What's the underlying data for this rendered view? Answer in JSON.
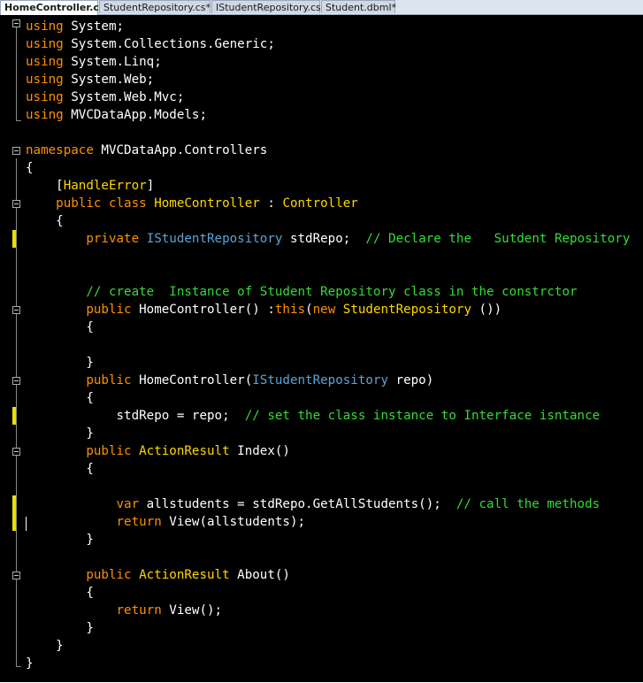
{
  "tabs": [
    {
      "label": "HomeController.cs*",
      "active": true
    },
    {
      "label": "StudentRepository.cs*",
      "active": false
    },
    {
      "label": "IStudentRepository.cs",
      "active": false
    },
    {
      "label": "Student.dbml*",
      "active": false
    }
  ],
  "colors": {
    "background": "#000000",
    "keyword": "#ff9000",
    "type": "#5aa5d6",
    "class": "#ffd700",
    "comment": "#33dd33",
    "plain": "#ffffff"
  },
  "code_lines": [
    [
      {
        "t": "kw",
        "v": "using"
      },
      {
        "t": "pl",
        "v": " System;"
      }
    ],
    [
      {
        "t": "kw",
        "v": "using"
      },
      {
        "t": "pl",
        "v": " System.Collections.Generic;"
      }
    ],
    [
      {
        "t": "kw",
        "v": "using"
      },
      {
        "t": "pl",
        "v": " System.Linq;"
      }
    ],
    [
      {
        "t": "kw",
        "v": "using"
      },
      {
        "t": "pl",
        "v": " System.Web;"
      }
    ],
    [
      {
        "t": "kw",
        "v": "using"
      },
      {
        "t": "pl",
        "v": " System.Web.Mvc;"
      }
    ],
    [
      {
        "t": "kw",
        "v": "using"
      },
      {
        "t": "pl",
        "v": " MVCDataApp.Models;"
      }
    ],
    [],
    [
      {
        "t": "kw",
        "v": "namespace"
      },
      {
        "t": "pl",
        "v": " MVCDataApp.Controllers"
      }
    ],
    [
      {
        "t": "pl",
        "v": "{"
      }
    ],
    [
      {
        "t": "pl",
        "v": "    ["
      },
      {
        "t": "cl",
        "v": "HandleError"
      },
      {
        "t": "pl",
        "v": "]"
      }
    ],
    [
      {
        "t": "pl",
        "v": "    "
      },
      {
        "t": "kw",
        "v": "public class"
      },
      {
        "t": "pl",
        "v": " "
      },
      {
        "t": "cl",
        "v": "HomeController"
      },
      {
        "t": "pl",
        "v": " : "
      },
      {
        "t": "cl",
        "v": "Controller"
      }
    ],
    [
      {
        "t": "pl",
        "v": "    {"
      }
    ],
    [
      {
        "t": "pl",
        "v": "        "
      },
      {
        "t": "kw",
        "v": "private"
      },
      {
        "t": "pl",
        "v": " "
      },
      {
        "t": "ty",
        "v": "IStudentRepository"
      },
      {
        "t": "pl",
        "v": " stdRepo;  "
      },
      {
        "t": "cm",
        "v": "// Declare the   Sutdent Repository"
      }
    ],
    [],
    [],
    [
      {
        "t": "pl",
        "v": "        "
      },
      {
        "t": "cm",
        "v": "// create  Instance of Student Repository class in the constrctor"
      }
    ],
    [
      {
        "t": "pl",
        "v": "        "
      },
      {
        "t": "kw",
        "v": "public"
      },
      {
        "t": "pl",
        "v": " HomeController() :"
      },
      {
        "t": "kw",
        "v": "this"
      },
      {
        "t": "pl",
        "v": "("
      },
      {
        "t": "kw",
        "v": "new"
      },
      {
        "t": "pl",
        "v": " "
      },
      {
        "t": "cl",
        "v": "StudentRepository"
      },
      {
        "t": "pl",
        "v": " ())"
      }
    ],
    [
      {
        "t": "pl",
        "v": "        {"
      }
    ],
    [],
    [
      {
        "t": "pl",
        "v": "        }"
      }
    ],
    [
      {
        "t": "pl",
        "v": "        "
      },
      {
        "t": "kw",
        "v": "public"
      },
      {
        "t": "pl",
        "v": " HomeController("
      },
      {
        "t": "ty",
        "v": "IStudentRepository"
      },
      {
        "t": "pl",
        "v": " repo)"
      }
    ],
    [
      {
        "t": "pl",
        "v": "        {"
      }
    ],
    [
      {
        "t": "pl",
        "v": "            stdRepo = repo;  "
      },
      {
        "t": "cm",
        "v": "// set the class instance to Interface isntance"
      }
    ],
    [
      {
        "t": "pl",
        "v": "        }"
      }
    ],
    [
      {
        "t": "pl",
        "v": "        "
      },
      {
        "t": "kw",
        "v": "public"
      },
      {
        "t": "pl",
        "v": " "
      },
      {
        "t": "cl",
        "v": "ActionResult"
      },
      {
        "t": "pl",
        "v": " Index()"
      }
    ],
    [
      {
        "t": "pl",
        "v": "        {"
      }
    ],
    [],
    [
      {
        "t": "pl",
        "v": "            "
      },
      {
        "t": "kw",
        "v": "var"
      },
      {
        "t": "pl",
        "v": " allstudents = stdRepo.GetAllStudents();  "
      },
      {
        "t": "cm",
        "v": "// call the methods"
      }
    ],
    [
      {
        "t": "pl",
        "v": "            "
      },
      {
        "t": "kw",
        "v": "return"
      },
      {
        "t": "pl",
        "v": " View(allstudents);"
      }
    ],
    [
      {
        "t": "pl",
        "v": "        }"
      }
    ],
    [],
    [
      {
        "t": "pl",
        "v": "        "
      },
      {
        "t": "kw",
        "v": "public"
      },
      {
        "t": "pl",
        "v": " "
      },
      {
        "t": "cl",
        "v": "ActionResult"
      },
      {
        "t": "pl",
        "v": " About()"
      }
    ],
    [
      {
        "t": "pl",
        "v": "        {"
      }
    ],
    [
      {
        "t": "pl",
        "v": "            "
      },
      {
        "t": "kw",
        "v": "return"
      },
      {
        "t": "pl",
        "v": " View();"
      }
    ],
    [
      {
        "t": "pl",
        "v": "        }"
      }
    ],
    [
      {
        "t": "pl",
        "v": "    }"
      }
    ],
    [
      {
        "t": "pl",
        "v": "}"
      }
    ]
  ]
}
